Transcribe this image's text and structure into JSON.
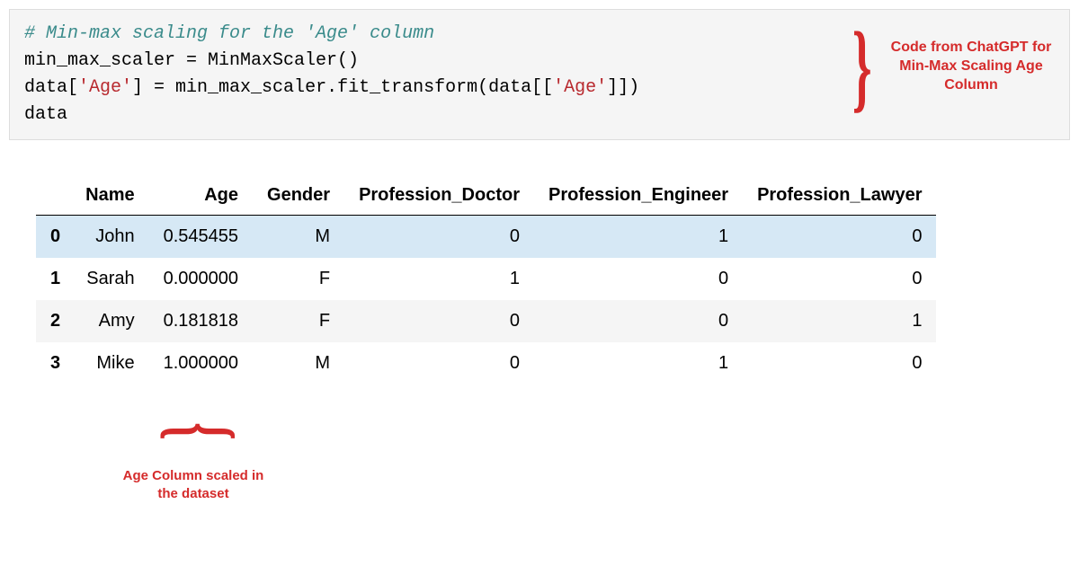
{
  "code": {
    "comment": "# Min-max scaling for the 'Age' column",
    "line1_prefix": "min_max_scaler = MinMaxScaler()",
    "line2_part1": "data[",
    "line2_str1": "'Age'",
    "line2_part2": "] = min_max_scaler.fit_transform(data[[",
    "line2_str2": "'Age'",
    "line2_part3": "]])",
    "line3": "data"
  },
  "annotation_right": "Code from ChatGPT for Min-Max Scaling Age Column",
  "annotation_bottom": "Age Column scaled in the dataset",
  "table": {
    "headers": [
      "",
      "Name",
      "Age",
      "Gender",
      "Profession_Doctor",
      "Profession_Engineer",
      "Profession_Lawyer"
    ],
    "rows": [
      {
        "idx": "0",
        "name": "John",
        "age": "0.545455",
        "gender": "M",
        "doctor": "0",
        "engineer": "1",
        "lawyer": "0"
      },
      {
        "idx": "1",
        "name": "Sarah",
        "age": "0.000000",
        "gender": "F",
        "doctor": "1",
        "engineer": "0",
        "lawyer": "0"
      },
      {
        "idx": "2",
        "name": "Amy",
        "age": "0.181818",
        "gender": "F",
        "doctor": "0",
        "engineer": "0",
        "lawyer": "1"
      },
      {
        "idx": "3",
        "name": "Mike",
        "age": "1.000000",
        "gender": "M",
        "doctor": "0",
        "engineer": "1",
        "lawyer": "0"
      }
    ]
  }
}
